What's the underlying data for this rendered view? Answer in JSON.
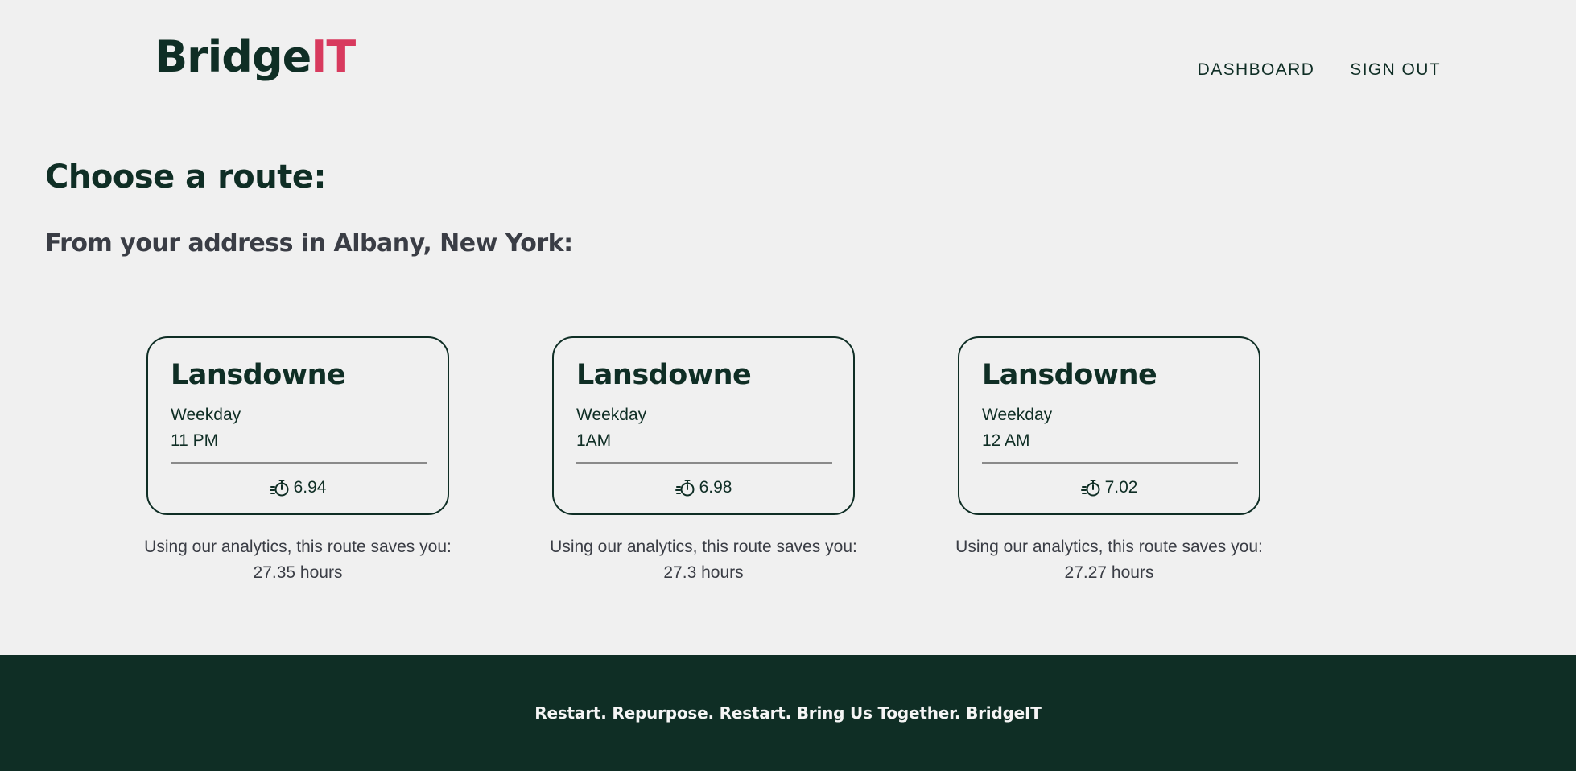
{
  "header": {
    "logo_main": "Bridge",
    "logo_accent": "IT",
    "nav": [
      {
        "label": "DASHBOARD"
      },
      {
        "label": "SIGN OUT"
      }
    ]
  },
  "main": {
    "title": "Choose a route:",
    "subtitle": "From your address in Albany, New York:",
    "routes": [
      {
        "name": "Lansdowne",
        "day": "Weekday",
        "time": "11 PM",
        "duration": "6.94",
        "savings_text": "Using our analytics, this route saves you:",
        "savings_value": "27.35 hours"
      },
      {
        "name": "Lansdowne",
        "day": "Weekday",
        "time": "1AM",
        "duration": "6.98",
        "savings_text": "Using our analytics, this route saves you:",
        "savings_value": "27.3 hours"
      },
      {
        "name": "Lansdowne",
        "day": "Weekday",
        "time": "12 AM",
        "duration": "7.02",
        "savings_text": "Using our analytics, this route saves you:",
        "savings_value": "27.27 hours"
      }
    ]
  },
  "icons": {
    "duration": "timer-icon"
  },
  "colors": {
    "primary": "#0f2e25",
    "accent": "#d83a5e",
    "background": "#f0f0f0",
    "muted_text": "#3a3d45",
    "footer_text": "#f5f5f5"
  },
  "footer": {
    "tagline": "Restart. Repurpose. Restart. Bring Us Together. BridgeIT"
  }
}
